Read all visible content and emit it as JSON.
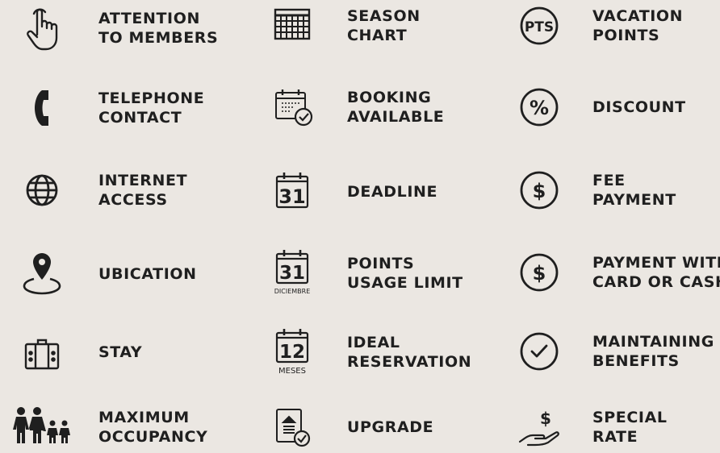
{
  "column1": [
    {
      "lines": [
        "ATTENTION",
        "TO MEMBERS"
      ],
      "icon": "hand-pointer-icon"
    },
    {
      "lines": [
        "TELEPHONE",
        "CONTACT"
      ],
      "icon": "telephone-icon"
    },
    {
      "lines": [
        "INTERNET",
        "ACCESS"
      ],
      "icon": "globe-icon"
    },
    {
      "lines": [
        "UBICATION"
      ],
      "icon": "location-pin-icon"
    },
    {
      "lines": [
        "STAY"
      ],
      "icon": "suitcase-icon"
    },
    {
      "lines": [
        "MAXIMUM",
        "OCCUPANCY"
      ],
      "icon": "family-icon"
    }
  ],
  "column2": [
    {
      "lines": [
        "SEASON",
        "CHART"
      ],
      "icon": "grid-chart-icon"
    },
    {
      "lines": [
        "BOOKING",
        "AVAILABLE"
      ],
      "icon": "calendar-check-icon"
    },
    {
      "lines": [
        "DEADLINE"
      ],
      "icon": "calendar-31-icon",
      "icon_text": "31"
    },
    {
      "lines": [
        "POINTS",
        "USAGE LIMIT"
      ],
      "icon": "calendar-31-diciembre-icon",
      "icon_text": "31",
      "icon_caption": "DICIEMBRE"
    },
    {
      "lines": [
        "IDEAL",
        "RESERVATION"
      ],
      "icon": "calendar-12-meses-icon",
      "icon_text": "12",
      "icon_caption": "MESES"
    },
    {
      "lines": [
        "UPGRADE"
      ],
      "icon": "upgrade-document-icon"
    }
  ],
  "column3": [
    {
      "lines": [
        "VACATION",
        "POINTS"
      ],
      "icon": "pts-circle-icon",
      "icon_text": "PTS"
    },
    {
      "lines": [
        "DISCOUNT"
      ],
      "icon": "percent-circle-icon",
      "icon_text": "%"
    },
    {
      "lines": [
        "FEE",
        "PAYMENT"
      ],
      "icon": "dollar-circle-icon",
      "icon_text": "$"
    },
    {
      "lines": [
        "PAYMENT WITH",
        "CARD OR CASH"
      ],
      "icon": "dollar-circle-icon",
      "icon_text": "$"
    },
    {
      "lines": [
        "MAINTAINING",
        "BENEFITS"
      ],
      "icon": "checkmark-circle-icon"
    },
    {
      "lines": [
        "SPECIAL",
        "RATE"
      ],
      "icon": "hand-dollar-icon",
      "icon_text": "$"
    }
  ]
}
